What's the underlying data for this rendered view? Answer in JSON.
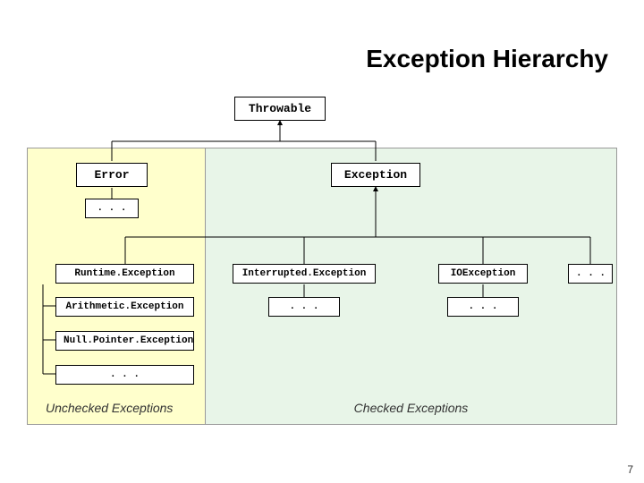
{
  "title": "Exception Hierarchy",
  "nodes": {
    "throwable": "Throwable",
    "error": "Error",
    "exception": "Exception",
    "runtime": "Runtime.Exception",
    "arithmetic": "Arithmetic.Exception",
    "nullpointer": "Null.Pointer.Exception",
    "interrupted": "Interrupted.Exception",
    "ioexception": "IOException",
    "error_ellipsis": ". . .",
    "runtime_ellipsis": ". . .",
    "interrupted_ellipsis": ". . .",
    "ioexception_ellipsis": ". . .",
    "exception_ellipsis": ". . ."
  },
  "regions": {
    "unchecked": "Unchecked Exceptions",
    "checked": "Checked Exceptions"
  },
  "page_number": "7"
}
